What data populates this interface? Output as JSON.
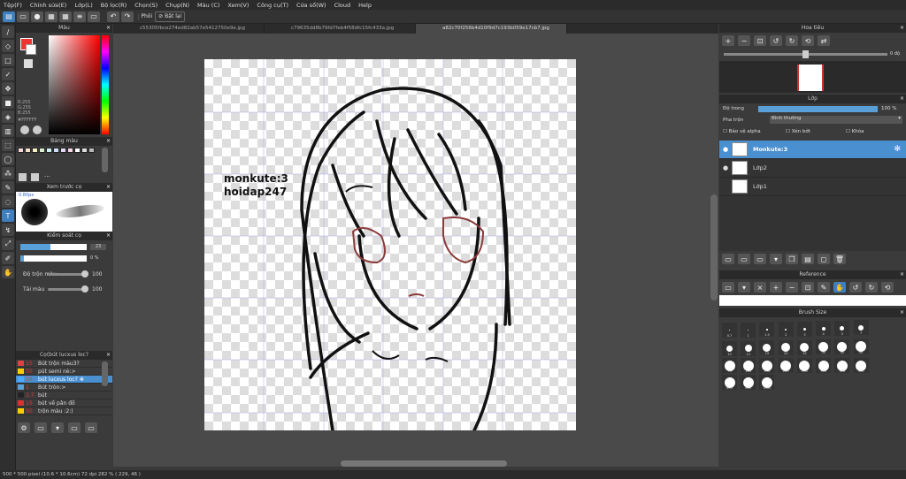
{
  "menu": [
    "Tệp(F)",
    "Chỉnh sửa(E)",
    "Lớp(L)",
    "Bộ lọc(R)",
    "Chọn(S)",
    "Chụp(N)",
    "Màu (C)",
    "Xem(V)",
    "Công cụ(T)",
    "Cửa sổ(W)",
    "Cloud",
    "Help"
  ],
  "toolbar": {
    "label1": "Phôi",
    "label2": "Bật lại"
  },
  "tabs": [
    "c55305fbce274ed82ab57e5412750e9e.jpg",
    "c79635dd8b79fd7feb4f58dfc15fc433a.jpg",
    "a82c70f256b4d10f9d7c193b059e17cb7.jpg"
  ],
  "left": {
    "color_title": "Màu",
    "color_values": {
      "r": "R:255",
      "g": "G:255",
      "b": "B:255",
      "hex": "#FFFFFF"
    },
    "palette_title": "Bảng màu",
    "preview_title": "Xem trước cọ",
    "preview_size": "0.80px",
    "control_title": "Kiểm soát cọ",
    "size_value": "23",
    "opacity_value": "0 %",
    "blend_label": "Độ trộn màu",
    "blend_value": "100",
    "mix_label": "Tải màu",
    "mix_value": "100",
    "brush_list_title": "Cọ(bút lucxus loc?",
    "brushes": [
      {
        "size": "15",
        "name": "Bút trộn màu3?",
        "color": "#e04040"
      },
      {
        "size": "50",
        "name": "pút semi nè:>",
        "color": "#ffcc00"
      },
      {
        "size": "20",
        "name": "bút lucxus loc?",
        "color": "#4aa8ff"
      },
      {
        "size": "1",
        "name": "Bút tròn:>",
        "color": "#5aa0d8"
      },
      {
        "size": "1.7",
        "name": "bút",
        "color": "#222222"
      },
      {
        "size": "15",
        "name": "bút về pân đồ",
        "color": "#e03030"
      },
      {
        "size": "50",
        "name": "trộn màu :2:)",
        "color": "#ffcc00"
      }
    ]
  },
  "canvas_text": {
    "line1": "monkute:3",
    "line2": "hoidap247"
  },
  "status": "500 * 500 pixel  (10.6 * 10.6cm)  72 dpi  282 %  ( 229, 46 )",
  "right": {
    "nav_title": "Hoa tiêu",
    "nav_angle": "0 độ",
    "layer_title": "Lớp",
    "opacity_label": "Độ trong",
    "opacity_value": "100 %",
    "blend_label": "Pha trộn",
    "blend_value": "Bình thường",
    "protect_alpha": "Bảo vệ alpha",
    "clipping": "Xén bớt",
    "lock": "Khóa",
    "layers": [
      {
        "name": "Monkute:3",
        "selected": true
      },
      {
        "name": "Lớp2",
        "selected": false
      },
      {
        "name": "Lớp1",
        "selected": false
      }
    ],
    "reference_title": "Reference",
    "brush_size_title": "Brush Size",
    "brush_sizes_row1": [
      "0.7",
      "1",
      "1.5",
      "2",
      "3",
      "4",
      "5",
      "7"
    ],
    "brush_sizes_row2": [
      "10",
      "12",
      "15",
      "20",
      "25",
      "30",
      "40",
      "50"
    ],
    "brush_sizes_row3": [
      "70",
      "100",
      "150",
      "200",
      "250",
      "300",
      "400",
      "500"
    ],
    "brush_sizes_row4": [
      "600",
      "800",
      "1000"
    ]
  },
  "colors": {
    "accent": "#4a8fd0",
    "line": "#111111",
    "eye": "#8b3a3a"
  }
}
